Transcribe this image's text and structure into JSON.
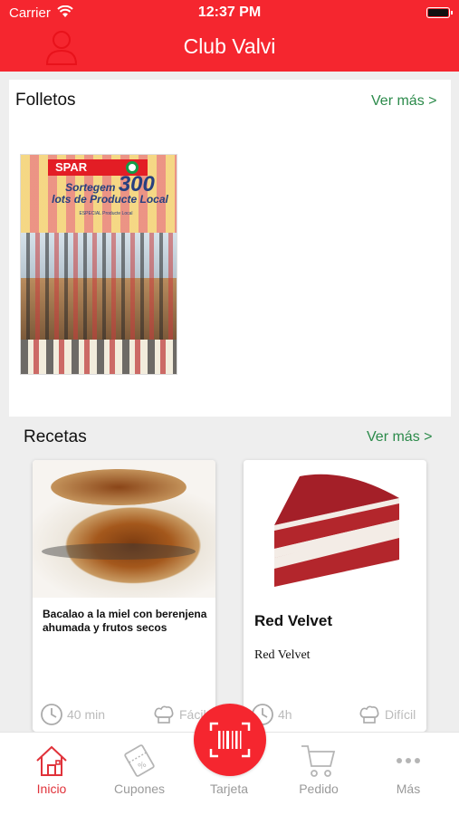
{
  "status_bar": {
    "carrier": "Carrier",
    "time": "12:37 PM"
  },
  "header": {
    "title": "Club Valvi",
    "user_icon": "user-icon"
  },
  "folletos": {
    "title": "Folletos",
    "ver_mas": "Ver más >",
    "flyer": {
      "brand": "SPAR",
      "headline_1": "Sortegem",
      "headline_num": "300",
      "headline_2": "lots de Producte Local",
      "tag": "ESPECIAL Producte Local"
    }
  },
  "recetas": {
    "title": "Recetas",
    "ver_mas": "Ver más >",
    "items": [
      {
        "name": "Bacalao a la miel con berenjena ahumada y frutos secos",
        "time": "40 min",
        "difficulty": "Fácil"
      },
      {
        "name": "Red Velvet",
        "description": "Red Velvet",
        "time": "4h",
        "difficulty": "Difícil"
      }
    ]
  },
  "tabbar": {
    "tabs": [
      {
        "label": "Inicio",
        "icon": "home-icon",
        "active": true
      },
      {
        "label": "Cupones",
        "icon": "coupon-icon"
      },
      {
        "label": "Tarjeta",
        "icon": "barcode-scan-icon"
      },
      {
        "label": "Pedido",
        "icon": "cart-icon"
      },
      {
        "label": "Más",
        "icon": "more-icon"
      }
    ]
  },
  "colors": {
    "brand_red": "#f5262f",
    "link_green": "#2b8a4a",
    "inactive_gray": "#9a9a9a"
  }
}
